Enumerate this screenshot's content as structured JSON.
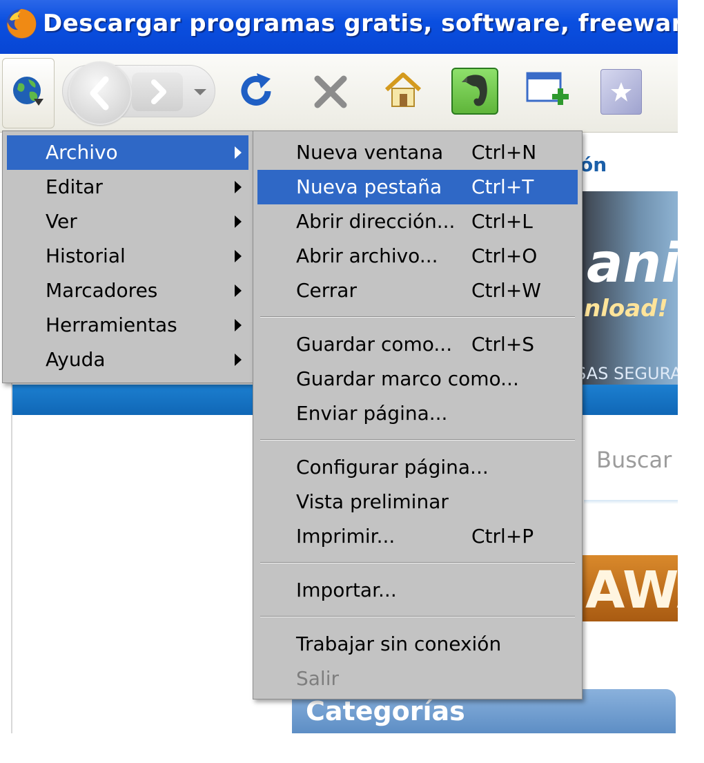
{
  "window": {
    "title": "Descargar programas gratis, software, freeware, juegos"
  },
  "toolbar": {
    "icons": [
      "firefox-menu-globe-icon",
      "back-icon",
      "forward-icon",
      "history-dropdown-icon",
      "reload-icon",
      "stop-icon",
      "home-icon",
      "evernote-icon",
      "new-window-icon",
      "bookmark-star-icon"
    ]
  },
  "page": {
    "link_fragment": "ón",
    "logo_fragment": "anic",
    "slogan_fragment": "nload!",
    "tagline_fragment": "SAS SEGURAS",
    "search_placeholder": "Buscar",
    "banner_fragment": "AWA",
    "categories_header": "Categorías"
  },
  "main_menu": {
    "items": [
      {
        "label": "Archivo",
        "selected": true
      },
      {
        "label": "Editar"
      },
      {
        "label": "Ver"
      },
      {
        "label": "Historial"
      },
      {
        "label": "Marcadores"
      },
      {
        "label": "Herramientas"
      },
      {
        "label": "Ayuda"
      }
    ]
  },
  "file_menu": {
    "group1": [
      {
        "label": "Nueva ventana",
        "shortcut": "Ctrl+N"
      },
      {
        "label": "Nueva pestaña",
        "shortcut": "Ctrl+T",
        "selected": true
      },
      {
        "label": "Abrir dirección...",
        "shortcut": "Ctrl+L"
      },
      {
        "label": "Abrir archivo...",
        "shortcut": "Ctrl+O"
      },
      {
        "label": "Cerrar",
        "shortcut": "Ctrl+W"
      }
    ],
    "group2": [
      {
        "label": "Guardar como...",
        "shortcut": "Ctrl+S"
      },
      {
        "label": "Guardar marco como...",
        "shortcut": ""
      },
      {
        "label": "Enviar página...",
        "shortcut": ""
      }
    ],
    "group3": [
      {
        "label": "Configurar página...",
        "shortcut": ""
      },
      {
        "label": "Vista preliminar",
        "shortcut": ""
      },
      {
        "label": "Imprimir...",
        "shortcut": "Ctrl+P"
      }
    ],
    "group4": [
      {
        "label": "Importar...",
        "shortcut": ""
      }
    ],
    "group5": [
      {
        "label": "Trabajar sin conexión",
        "shortcut": ""
      },
      {
        "label": "Salir",
        "shortcut": "",
        "disabled": true
      }
    ]
  },
  "colors": {
    "titlebar": "#0a4fe0",
    "menu_bg": "#c3c3c3",
    "menu_highlight": "#2f68c6"
  }
}
